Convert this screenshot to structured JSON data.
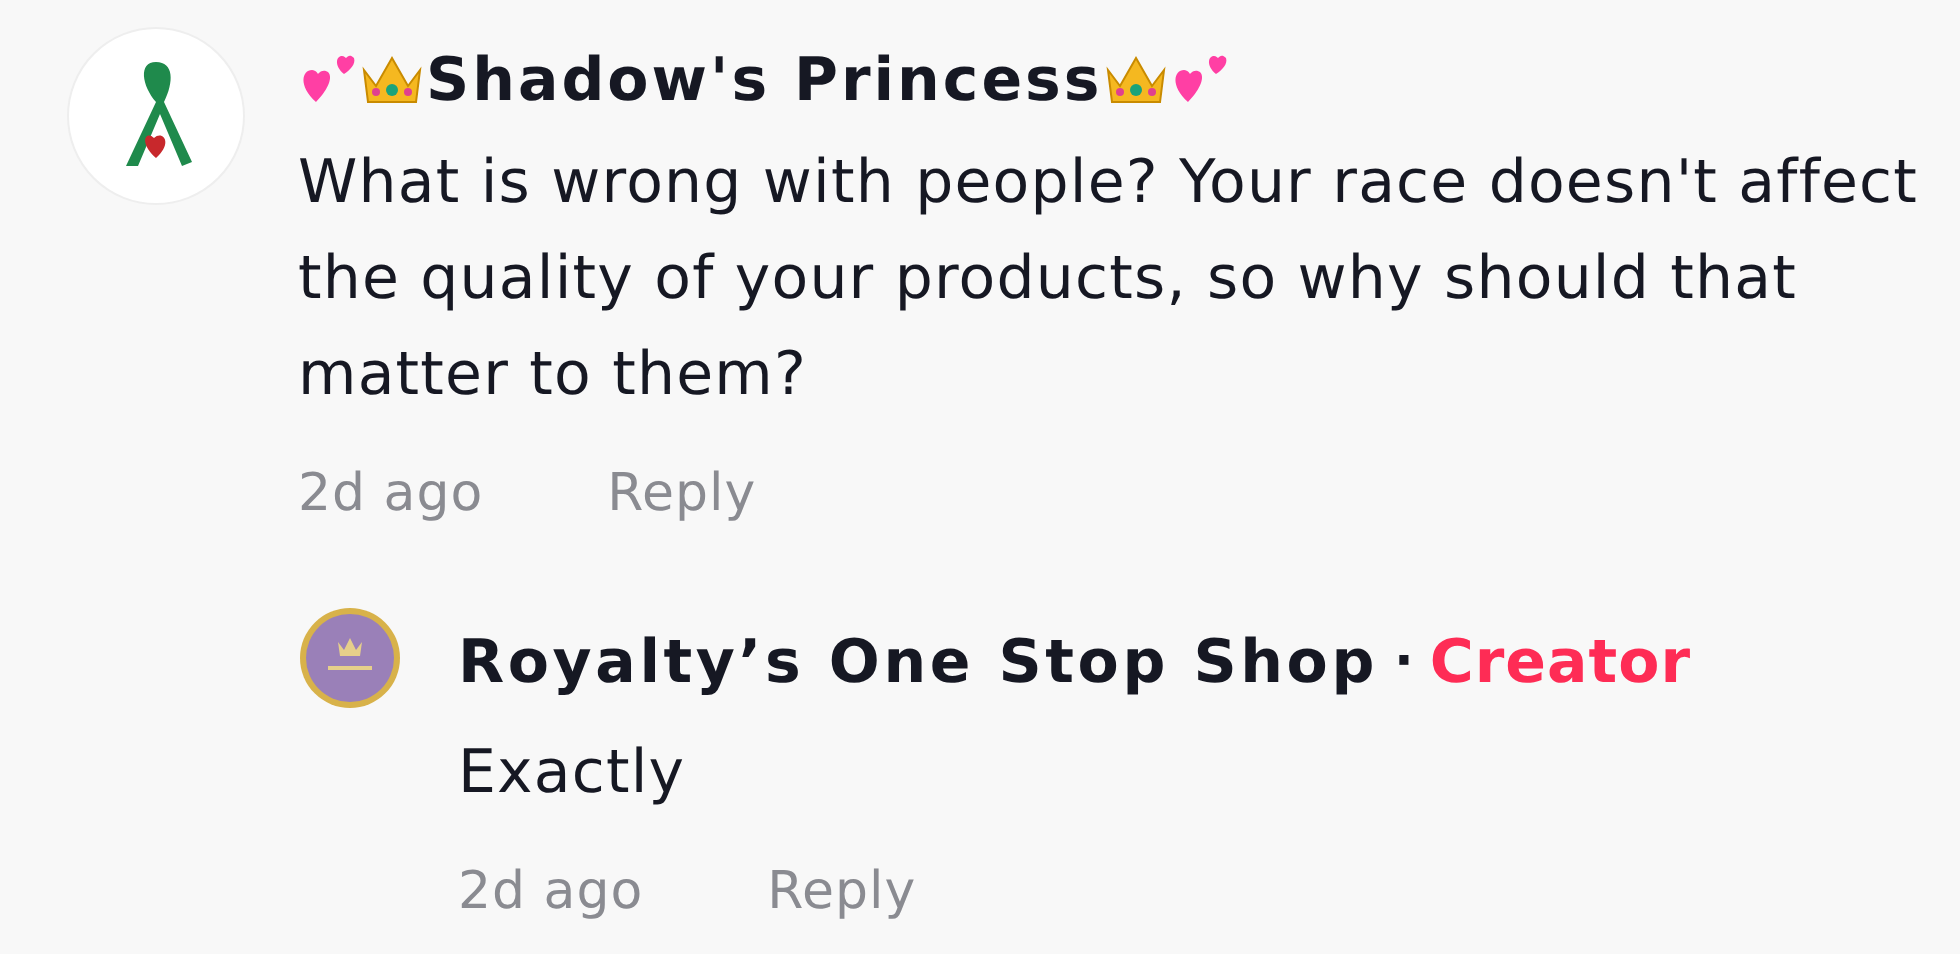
{
  "comments": [
    {
      "author": "Shadow's Princess",
      "badge_emoji": true,
      "text": "What is wrong with people? Your race doesn't affect the quality of your products, so why should that matter to them?",
      "time": "2d ago",
      "reply_label": "Reply",
      "replies": [
        {
          "author": "Royalty’s One Stop Shop",
          "separator": "·",
          "role": "Creator",
          "text": "Exactly",
          "time": "2d ago",
          "reply_label": "Reply"
        }
      ]
    }
  ]
}
